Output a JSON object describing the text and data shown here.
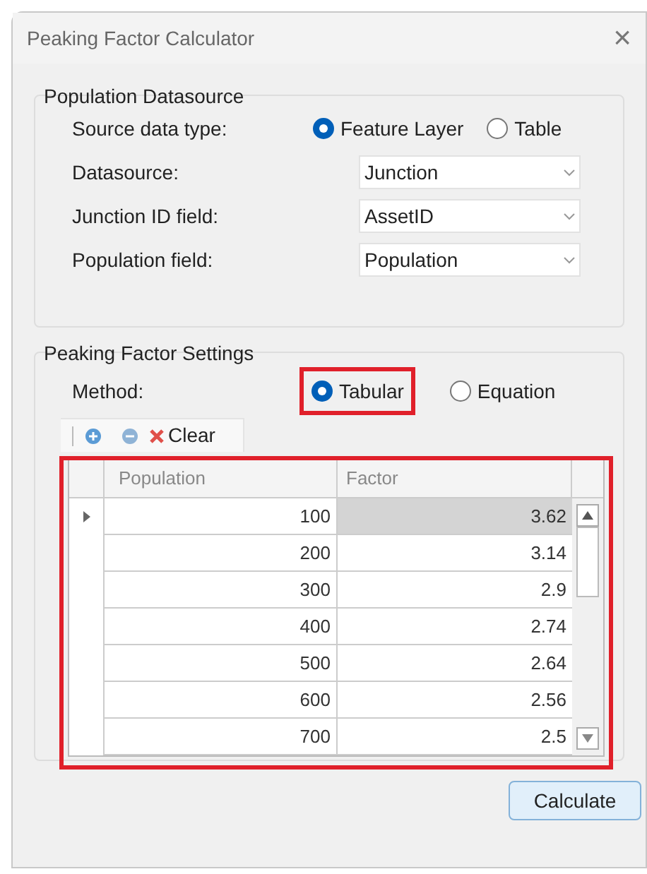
{
  "window": {
    "title": "Peaking Factor Calculator",
    "close": "×"
  },
  "population_datasource": {
    "title": "Population Datasource",
    "source_type": {
      "label": "Source data type:",
      "options": [
        {
          "label": "Feature Layer",
          "selected": true,
          "highlighted": false
        },
        {
          "label": "Table",
          "selected": false,
          "highlighted": false
        }
      ]
    },
    "fields": [
      {
        "label": "Datasource:",
        "value": "Junction"
      },
      {
        "label": "Junction ID field:",
        "value": "AssetID"
      },
      {
        "label": "Population field:",
        "value": "Population"
      }
    ]
  },
  "peaking_factor_settings": {
    "title": "Peaking Factor Settings",
    "method": {
      "label": "Method:",
      "options": [
        {
          "label": "Tabular",
          "selected": true,
          "highlighted": true
        },
        {
          "label": "Equation",
          "selected": false,
          "highlighted": false
        }
      ]
    },
    "toolbar": {
      "clear": "Clear"
    },
    "table": {
      "highlighted": true,
      "columns": [
        "Population",
        "Factor"
      ],
      "rows": [
        {
          "population": "100",
          "factor": "3.62",
          "selected": true
        },
        {
          "population": "200",
          "factor": "3.14",
          "selected": false
        },
        {
          "population": "300",
          "factor": "2.9",
          "selected": false
        },
        {
          "population": "400",
          "factor": "2.74",
          "selected": false
        },
        {
          "population": "500",
          "factor": "2.64",
          "selected": false
        },
        {
          "population": "600",
          "factor": "2.56",
          "selected": false
        },
        {
          "population": "700",
          "factor": "2.5",
          "selected": false
        }
      ]
    }
  },
  "buttons": [
    "Calculate"
  ]
}
